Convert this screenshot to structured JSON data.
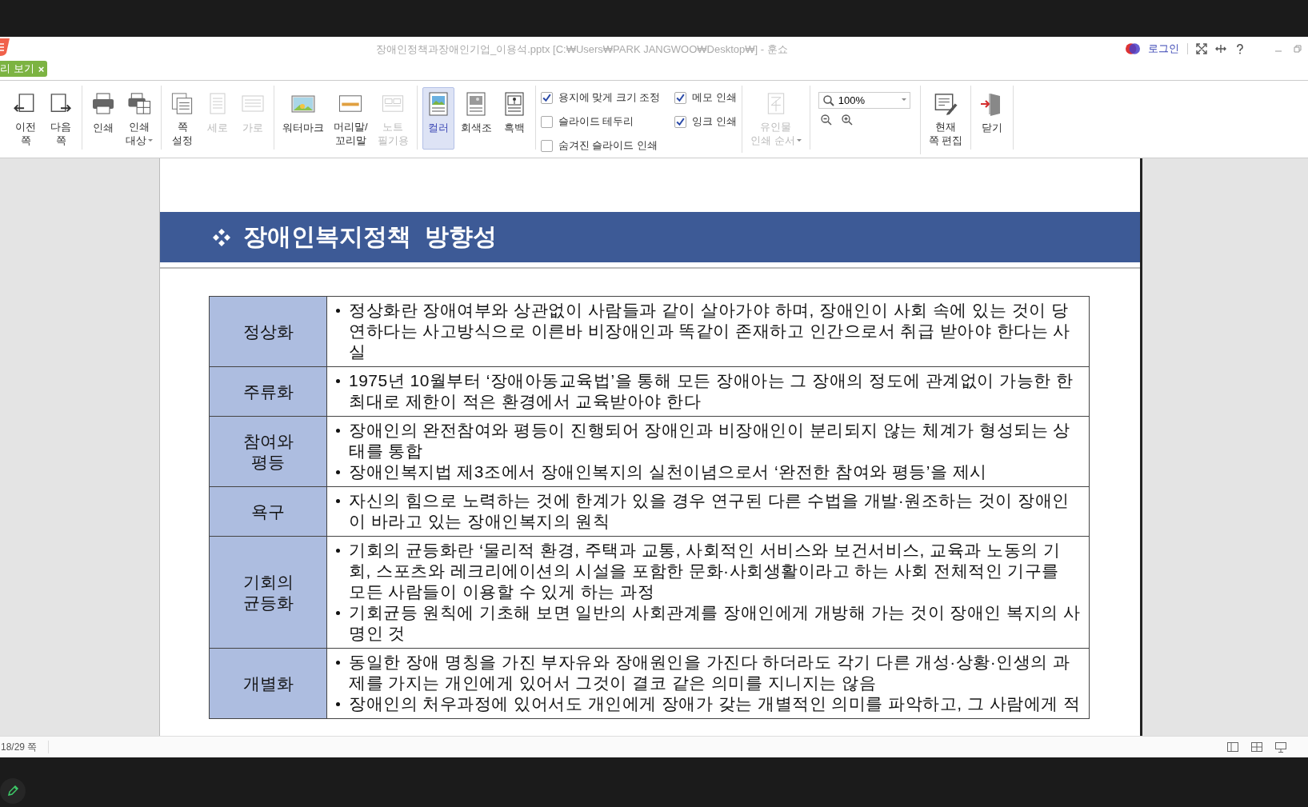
{
  "window": {
    "title": "장애인정책과장애인기업_이용석.pptx [C:₩Users₩PARK JANGWOO₩Desktop₩] - 훈쇼",
    "login": "로그인"
  },
  "tabs": [
    {
      "label": "리 보기",
      "close": "×",
      "selected": true
    }
  ],
  "toolbar": {
    "groups": [
      {
        "kind": "buttons",
        "buttons": [
          {
            "label": "이전\n쪽",
            "disabled": false,
            "dropdown": false
          },
          {
            "label": "다음\n쪽",
            "disabled": false,
            "dropdown": false
          }
        ]
      },
      {
        "kind": "buttons",
        "buttons": [
          {
            "label": "인쇄",
            "disabled": false,
            "dropdown": false
          },
          {
            "label": "인쇄\n대상",
            "disabled": false,
            "dropdown": true
          }
        ]
      },
      {
        "kind": "buttons",
        "buttons": [
          {
            "label": "쪽\n설정",
            "disabled": false,
            "dropdown": false
          },
          {
            "label": "세로",
            "disabled": true,
            "dropdown": false
          },
          {
            "label": "가로",
            "disabled": true,
            "dropdown": false
          }
        ]
      },
      {
        "kind": "buttons",
        "buttons": [
          {
            "label": "워터마크",
            "disabled": false,
            "dropdown": false
          },
          {
            "label": "머리말/\n꼬리말",
            "disabled": false,
            "dropdown": false
          },
          {
            "label": "노트\n필기용",
            "disabled": true,
            "dropdown": false
          }
        ]
      },
      {
        "kind": "choice",
        "buttons": [
          {
            "label": "컬러",
            "selected": true
          },
          {
            "label": "회색조",
            "selected": false
          },
          {
            "label": "흑백",
            "selected": false
          }
        ]
      },
      {
        "kind": "checkboxes",
        "options": [
          {
            "label": "용지에 맞게 크기 조정",
            "checked": true
          },
          {
            "label": "슬라이드 테두리",
            "checked": false
          },
          {
            "label": "숨겨진 슬라이드 인쇄",
            "checked": false
          },
          {
            "label": "메모 인쇄",
            "checked": true
          },
          {
            "label": "잉크 인쇄",
            "checked": true
          }
        ]
      },
      {
        "kind": "buttons",
        "buttons": [
          {
            "label": "유인물\n인쇄 순서",
            "disabled": true,
            "dropdown": true
          }
        ]
      },
      {
        "kind": "zoom",
        "value": "100%"
      },
      {
        "kind": "buttons",
        "buttons": [
          {
            "label": "현재\n쪽 편집",
            "disabled": false,
            "dropdown": false
          }
        ]
      },
      {
        "kind": "buttons",
        "buttons": [
          {
            "label": "닫기",
            "disabled": false,
            "dropdown": false
          }
        ]
      }
    ]
  },
  "slide": {
    "heading": "장애인복지정책  방향성",
    "rows": [
      {
        "term": "정상화",
        "bullets": [
          "정상화란 장애여부와 상관없이 사람들과 같이 살아가야 하며, 장애인이 사회 속에 있는 것이 당연하다는 사고방식으로 이른바 비장애인과 똑같이 존재하고 인간으로서 취급 받아야 한다는 사실"
        ]
      },
      {
        "term": "주류화",
        "bullets": [
          "1975년 10월부터 ‘장애아동교육법’을 통해 모든 장애아는 그 장애의 정도에 관계없이 가능한 한 최대로 제한이 적은 환경에서 교육받아야 한다"
        ]
      },
      {
        "term": "참여와\n평등",
        "bullets": [
          "장애인의 완전참여와 평등이 진행되어 장애인과 비장애인이 분리되지 않는 체계가 형성되는 상태를 통합",
          "장애인복지법 제3조에서 장애인복지의 실천이념으로서 ‘완전한 참여와 평등’을 제시"
        ]
      },
      {
        "term": "욕구",
        "bullets": [
          "자신의 힘으로 노력하는 것에 한계가 있을 경우 연구된 다른 수법을 개발·원조하는 것이 장애인이 바라고 있는 장애인복지의 원칙"
        ]
      },
      {
        "term": "기회의\n균등화",
        "bullets": [
          "기회의 균등화란 ‘물리적 환경, 주택과 교통, 사회적인 서비스와 보건서비스, 교육과 노동의 기회, 스포츠와 레크리에이션의 시설을 포함한 문화·사회생활이라고 하는 사회 전체적인 기구를 모든 사람들이 이용할 수 있게 하는 과정",
          "기회균등 원칙에 기초해 보면 일반의 사회관계를 장애인에게 개방해 가는 것이 장애인 복지의 사명인 것"
        ]
      },
      {
        "term": "개별화",
        "bullets": [
          "동일한 장애 명칭을 가진 부자유와 장애원인을 가진다 하더라도 각기 다른 개성·상황·인생의 과제를 가지는 개인에게 있어서 그것이 결코 같은 의미를 지니지는 않음",
          "장애인의 처우과정에 있어서도 개인에게 장애가 갖는 개별적인 의미를 파악하고, 그 사람에게 적"
        ]
      }
    ]
  },
  "status_bar": {
    "page": "18/29 쪽"
  }
}
